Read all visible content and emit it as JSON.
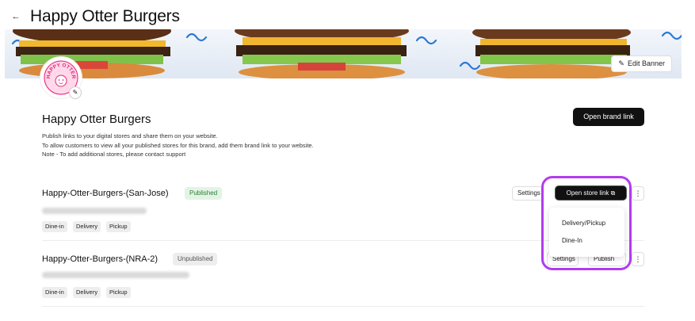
{
  "header": {
    "back_icon": "arrow-left-icon",
    "title": "Happy Otter Burgers"
  },
  "banner": {
    "edit_label": "Edit Banner",
    "edit_icon": "pencil-icon"
  },
  "logo": {
    "text": "HAPPY OTTER",
    "edit_icon": "pencil-icon",
    "accent": "#e6247a"
  },
  "brand": {
    "name": "Happy Otter Burgers",
    "desc_line1": "Publish links to your digital stores and share them on your website.",
    "desc_line2": "To allow customers to view all your published stores for this brand, add them brand link to your website.",
    "desc_line3": "Note - To add additional stores, please contact support",
    "open_brand_label": "Open brand link"
  },
  "stores": [
    {
      "name": "Happy-Otter-Burgers-(San-Jose)",
      "status": "Published",
      "tags": [
        "Dine-in",
        "Delivery",
        "Pickup"
      ],
      "settings_label": "Settings",
      "open_store_label": "Open store link",
      "open_icon": "external-link-icon",
      "menu_icon": "kebab-icon"
    },
    {
      "name": "Happy-Otter-Burgers-(NRA-2)",
      "status": "Unpublished",
      "tags": [
        "Dine-in",
        "Delivery",
        "Pickup"
      ],
      "settings_label": "Settings",
      "publish_label": "Publish",
      "menu_icon": "kebab-icon"
    }
  ],
  "dropdown": {
    "items": [
      "Delivery/Pickup",
      "Dine-In"
    ]
  },
  "colors": {
    "highlight": "#b13cf0",
    "published_bg": "#e3f4e5",
    "published_fg": "#2e7d32",
    "primary": "#111111"
  }
}
